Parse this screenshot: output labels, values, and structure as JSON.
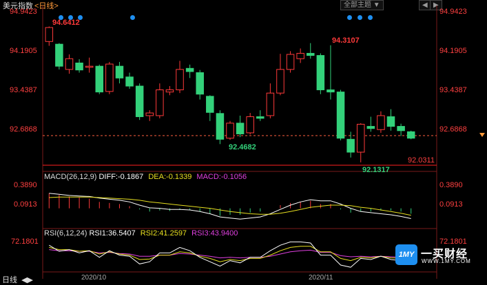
{
  "header": {
    "title": "美元指数",
    "period_tab": "<日线>",
    "topic_button": "全部主题",
    "prev_label": "◀",
    "next_label": "▶",
    "dropdown_label": "▼"
  },
  "price_axis": {
    "left": [
      "94.9423",
      "94.1905",
      "93.4387",
      "92.6868"
    ],
    "right": [
      "94.9423",
      "94.1905",
      "93.4387",
      "92.6868"
    ],
    "current_price": "92.0311"
  },
  "annotations": {
    "high_left": "94.6412",
    "high_right": "94.3107",
    "low_left": "92.4682",
    "low_right": "92.1317"
  },
  "macd": {
    "label": "MACD(26,12,9)",
    "diff": "DIFF:-0.1867",
    "dea": "DEA:-0.1339",
    "macd": "MACD:-0.1056",
    "axis": [
      "0.3890",
      "0.0913"
    ]
  },
  "rsi": {
    "label": "RSI(6,12,24)",
    "rsi1": "RSI1:36.5407",
    "rsi2": "RSI2:41.2597",
    "rsi3": "RSI3:43.9400",
    "axis": "72.1801"
  },
  "x_axis": {
    "period": "日线",
    "labels": [
      "2020/10",
      "2020/11"
    ]
  },
  "watermark": {
    "logo": "1MY",
    "name": "一买财经",
    "url": "WWW.1MY.COM"
  },
  "colors": {
    "up": "#ff3a3a",
    "down": "#33d17a",
    "accent": "#1e8ff0",
    "diff": "#ffffff",
    "dea": "#e8e020",
    "macd": "#e040e0"
  },
  "chart_data": {
    "type": "candlestick",
    "ylim": [
      92.0,
      95.05
    ],
    "candles": [
      {
        "o": 94.38,
        "c": 94.64,
        "h": 94.66,
        "l": 94.3
      },
      {
        "o": 94.33,
        "c": 93.92,
        "h": 94.35,
        "l": 93.86
      },
      {
        "o": 93.86,
        "c": 94.06,
        "h": 94.14,
        "l": 93.78
      },
      {
        "o": 93.98,
        "c": 93.85,
        "h": 94.05,
        "l": 93.8
      },
      {
        "o": 93.9,
        "c": 93.92,
        "h": 94.08,
        "l": 93.8
      },
      {
        "o": 93.92,
        "c": 93.44,
        "h": 93.95,
        "l": 93.4
      },
      {
        "o": 93.45,
        "c": 93.96,
        "h": 94.0,
        "l": 93.4
      },
      {
        "o": 93.92,
        "c": 93.7,
        "h": 94.0,
        "l": 93.6
      },
      {
        "o": 93.72,
        "c": 93.55,
        "h": 93.8,
        "l": 93.5
      },
      {
        "o": 93.55,
        "c": 92.98,
        "h": 93.6,
        "l": 92.92
      },
      {
        "o": 93.0,
        "c": 93.05,
        "h": 93.1,
        "l": 92.9
      },
      {
        "o": 93.0,
        "c": 93.48,
        "h": 93.6,
        "l": 92.95
      },
      {
        "o": 93.44,
        "c": 93.48,
        "h": 93.55,
        "l": 93.38
      },
      {
        "o": 93.48,
        "c": 93.86,
        "h": 94.02,
        "l": 93.42
      },
      {
        "o": 93.88,
        "c": 93.82,
        "h": 93.95,
        "l": 93.7
      },
      {
        "o": 93.8,
        "c": 93.4,
        "h": 93.85,
        "l": 93.3
      },
      {
        "o": 93.36,
        "c": 93.06,
        "h": 93.38,
        "l": 92.9
      },
      {
        "o": 93.04,
        "c": 92.56,
        "h": 93.1,
        "l": 92.47
      },
      {
        "o": 92.58,
        "c": 92.86,
        "h": 92.9,
        "l": 92.55
      },
      {
        "o": 92.86,
        "c": 92.66,
        "h": 93.0,
        "l": 92.6
      },
      {
        "o": 92.68,
        "c": 92.98,
        "h": 93.05,
        "l": 92.65
      },
      {
        "o": 92.98,
        "c": 92.95,
        "h": 93.1,
        "l": 92.9
      },
      {
        "o": 93.0,
        "c": 93.42,
        "h": 93.6,
        "l": 92.95
      },
      {
        "o": 93.42,
        "c": 93.86,
        "h": 94.15,
        "l": 93.38
      },
      {
        "o": 93.86,
        "c": 94.14,
        "h": 94.2,
        "l": 93.8
      },
      {
        "o": 94.06,
        "c": 94.16,
        "h": 94.25,
        "l": 93.98
      },
      {
        "o": 94.16,
        "c": 94.12,
        "h": 94.35,
        "l": 94.06
      },
      {
        "o": 94.12,
        "c": 93.48,
        "h": 94.16,
        "l": 93.4
      },
      {
        "o": 93.48,
        "c": 93.44,
        "h": 94.31,
        "l": 93.3
      },
      {
        "o": 93.44,
        "c": 92.58,
        "h": 93.48,
        "l": 92.54
      },
      {
        "o": 92.56,
        "c": 92.32,
        "h": 92.7,
        "l": 92.22
      },
      {
        "o": 92.32,
        "c": 92.84,
        "h": 92.86,
        "l": 92.13
      },
      {
        "o": 92.8,
        "c": 92.76,
        "h": 92.98,
        "l": 92.7
      },
      {
        "o": 92.74,
        "c": 93.0,
        "h": 93.08,
        "l": 92.68
      },
      {
        "o": 92.98,
        "c": 92.8,
        "h": 93.12,
        "l": 92.72
      },
      {
        "o": 92.8,
        "c": 92.72,
        "h": 92.85,
        "l": 92.62
      },
      {
        "o": 92.7,
        "c": 92.58,
        "h": 92.72,
        "l": 92.56
      }
    ],
    "macd_range": [
      -0.35,
      0.52
    ],
    "macd_hist": [
      0.28,
      0.25,
      0.22,
      0.2,
      0.18,
      0.12,
      0.1,
      0.08,
      0.04,
      -0.02,
      -0.06,
      -0.04,
      -0.05,
      -0.03,
      -0.03,
      -0.06,
      -0.1,
      -0.14,
      -0.12,
      -0.12,
      -0.08,
      -0.06,
      0.0,
      0.06,
      0.1,
      0.12,
      0.14,
      0.08,
      0.08,
      -0.02,
      -0.08,
      -0.06,
      -0.06,
      -0.04,
      -0.04,
      -0.06,
      -0.1
    ],
    "macd_diff": [
      0.28,
      0.26,
      0.24,
      0.23,
      0.22,
      0.19,
      0.17,
      0.15,
      0.12,
      0.06,
      0.01,
      0.0,
      -0.02,
      -0.02,
      -0.03,
      -0.06,
      -0.1,
      -0.16,
      -0.18,
      -0.2,
      -0.18,
      -0.16,
      -0.1,
      -0.02,
      0.06,
      0.12,
      0.16,
      0.14,
      0.14,
      0.08,
      0.0,
      -0.06,
      -0.08,
      -0.1,
      -0.12,
      -0.15,
      -0.19
    ],
    "macd_dea": [
      0.2,
      0.21,
      0.21,
      0.21,
      0.21,
      0.2,
      0.19,
      0.18,
      0.17,
      0.15,
      0.12,
      0.1,
      0.08,
      0.06,
      0.04,
      0.02,
      0.0,
      -0.03,
      -0.06,
      -0.08,
      -0.1,
      -0.11,
      -0.11,
      -0.09,
      -0.06,
      -0.02,
      0.02,
      0.04,
      0.06,
      0.06,
      0.05,
      0.02,
      0.0,
      -0.03,
      -0.06,
      -0.09,
      -0.13
    ],
    "rsi_range": [
      20,
      80
    ],
    "rsi1": [
      66,
      55,
      58,
      52,
      56,
      44,
      56,
      48,
      46,
      32,
      36,
      52,
      52,
      62,
      56,
      44,
      36,
      28,
      38,
      34,
      44,
      44,
      56,
      66,
      72,
      72,
      70,
      48,
      48,
      30,
      26,
      42,
      40,
      46,
      40,
      38,
      36
    ],
    "rsi2": [
      62,
      58,
      58,
      55,
      56,
      50,
      54,
      50,
      48,
      40,
      41,
      48,
      48,
      54,
      52,
      46,
      42,
      36,
      40,
      38,
      42,
      42,
      48,
      56,
      62,
      64,
      64,
      54,
      54,
      42,
      38,
      44,
      43,
      46,
      43,
      42,
      41
    ],
    "rsi3": [
      58,
      56,
      56,
      55,
      55,
      52,
      53,
      51,
      50,
      46,
      46,
      48,
      48,
      51,
      50,
      48,
      46,
      43,
      44,
      43,
      44,
      44,
      46,
      50,
      54,
      56,
      57,
      53,
      53,
      47,
      45,
      46,
      45,
      46,
      45,
      44,
      44
    ]
  }
}
